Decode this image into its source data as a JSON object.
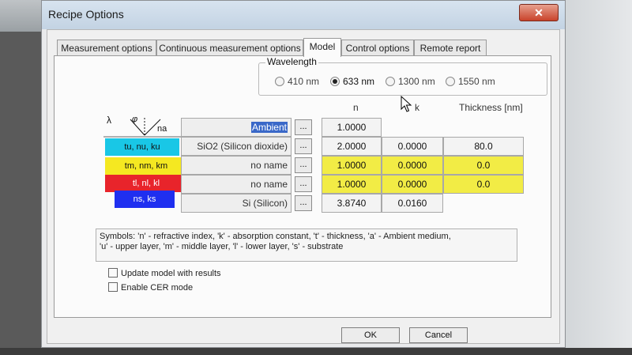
{
  "window": {
    "title": "Recipe Options",
    "close_label": "✕"
  },
  "tabs": [
    {
      "label": "Measurement options",
      "active": false
    },
    {
      "label": "Continuous measurement options",
      "active": false
    },
    {
      "label": "Model",
      "active": true
    },
    {
      "label": "Control options",
      "active": false
    },
    {
      "label": "Remote report",
      "active": false
    }
  ],
  "wavelength": {
    "legend": "Wavelength",
    "options": [
      {
        "label": "410 nm",
        "selected": false
      },
      {
        "label": "633 nm",
        "selected": true
      },
      {
        "label": "1300 nm",
        "selected": false
      },
      {
        "label": "1550 nm",
        "selected": false
      }
    ]
  },
  "headers": {
    "n": "n",
    "k": "k",
    "thickness": "Thickness [nm]"
  },
  "diagram": {
    "lambda": "λ",
    "phi": "φ",
    "na": "na",
    "layers": [
      {
        "label": "tu, nu, ku",
        "color": "#19c7e6"
      },
      {
        "label": "tm, nm, km",
        "color": "#f5e821"
      },
      {
        "label": "tl, nl, kl",
        "color": "#e8242b"
      },
      {
        "label": "ns, ks",
        "color": "#1f2ff0"
      }
    ]
  },
  "rows": [
    {
      "name": "Ambient",
      "selected": true,
      "button": "...",
      "n": "1.0000",
      "k": "",
      "thickness": "",
      "highlight": false
    },
    {
      "name": "SiO2 (Silicon dioxide)",
      "selected": false,
      "button": "...",
      "n": "2.0000",
      "k": "0.0000",
      "thickness": "80.0",
      "highlight": false
    },
    {
      "name": "no name",
      "selected": false,
      "button": "...",
      "n": "1.0000",
      "k": "0.0000",
      "thickness": "0.0",
      "highlight": true
    },
    {
      "name": "no name",
      "selected": false,
      "button": "...",
      "n": "1.0000",
      "k": "0.0000",
      "thickness": "0.0",
      "highlight": true
    },
    {
      "name": "Si (Silicon)",
      "selected": false,
      "button": "...",
      "n": "3.8740",
      "k": "0.0160",
      "thickness": "",
      "highlight": false
    }
  ],
  "symbols": {
    "line1": "Symbols: 'n' - refractive index, 'k' - absorption constant, 't' - thickness, 'a' - Ambient medium,",
    "line2": "'u' - upper layer, 'm' - middle layer, 'l' - lower layer, 's' - substrate"
  },
  "options": {
    "update_model": {
      "label": "Update model with results",
      "checked": false
    },
    "enable_cer": {
      "label": "Enable CER mode",
      "checked": false
    }
  },
  "buttons": {
    "ok": "OK",
    "cancel": "Cancel"
  }
}
